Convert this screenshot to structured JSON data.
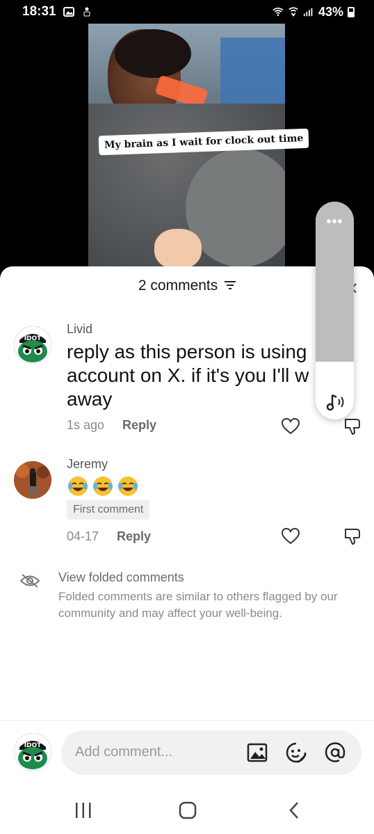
{
  "status_bar": {
    "time": "18:31",
    "battery_percent": "43%",
    "icons": [
      "gallery-icon",
      "notification-icon",
      "wifi-icon",
      "wifi-calling-icon",
      "signal-icon",
      "battery-icon"
    ]
  },
  "video": {
    "caption": "My brain as I wait for clock out time"
  },
  "sheet": {
    "title": "2 comments",
    "close_icon": "close-icon"
  },
  "comments": [
    {
      "username": "Livid",
      "text": "reply as this person is using your account on X. if it's you I'll walk away",
      "visible_text": "reply as this person is using\naccount on X. if it's you I'll w\naway",
      "time": "1s ago",
      "reply_label": "Reply",
      "avatar_text": "IDOT"
    },
    {
      "username": "Jeremy",
      "text": "😂😂😂",
      "badge": "First comment",
      "time": "04-17",
      "reply_label": "Reply"
    }
  ],
  "folded": {
    "title": "View folded comments",
    "description": "Folded comments are similar to others flagged by our community and may affect your well-being."
  },
  "composer": {
    "placeholder": "Add comment...",
    "avatar_text": "IDOT",
    "icons": [
      "image-icon",
      "sticker-icon",
      "mention-icon"
    ]
  },
  "navbar": {
    "icons": [
      "recent-apps-icon",
      "home-icon",
      "back-icon"
    ]
  },
  "colors": {
    "sheet_bg": "#ffffff",
    "text_primary": "#111111",
    "text_secondary": "#8a8a8a",
    "input_bg": "#f1f1f2",
    "idot_green": "#1f8a4c"
  }
}
